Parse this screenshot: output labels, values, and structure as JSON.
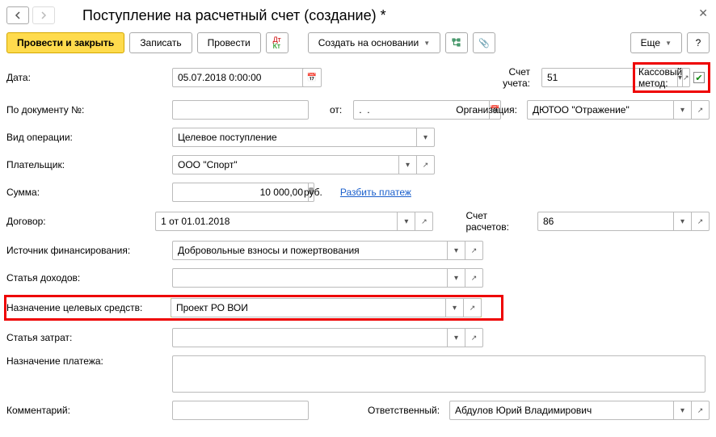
{
  "title": "Поступление на расчетный счет (создание) *",
  "toolbar": {
    "post_close": "Провести и закрыть",
    "save": "Записать",
    "post": "Провести",
    "create_based": "Создать на основании",
    "more": "Еще",
    "help": "?"
  },
  "labels": {
    "date": "Дата:",
    "account": "Счет учета:",
    "cash_method": "Кассовый метод:",
    "doc_num": "По документу №:",
    "from": "от:",
    "organization": "Организация:",
    "op_type": "Вид операции:",
    "payer": "Плательщик:",
    "sum": "Сумма:",
    "rub": "руб.",
    "split": "Разбить платеж",
    "contract": "Договор:",
    "settlement_acc": "Счет расчетов:",
    "fin_source": "Источник финансирования:",
    "income": "Статья доходов:",
    "target_funds": "Назначение целевых средств:",
    "expense": "Статья затрат:",
    "purpose": "Назначение платежа:",
    "comment": "Комментарий:",
    "responsible": "Ответственный:"
  },
  "values": {
    "date": "05.07.2018 0:00:00",
    "account": "51",
    "doc_num": "",
    "doc_date": ".  .",
    "organization": "ДЮТОО \"Отражение\"",
    "op_type": "Целевое поступление",
    "payer": "ООО \"Спорт\"",
    "sum": "10 000,00",
    "contract": "1 от 01.01.2018",
    "settlement_acc": "86",
    "fin_source": "Добровольные взносы и пожертвования",
    "income": "",
    "target_funds": "Проект РО ВОИ",
    "expense": "",
    "purpose": "",
    "comment": "",
    "responsible": "Абдулов Юрий Владимирович"
  }
}
